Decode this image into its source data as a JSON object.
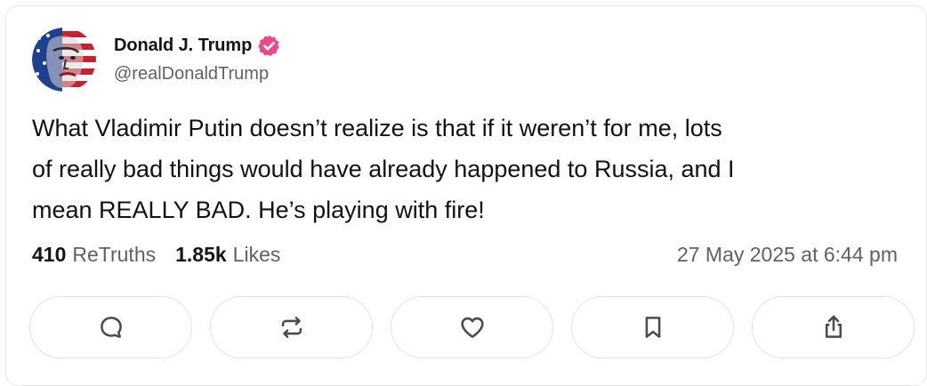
{
  "author": {
    "name": "Donald J. Trump",
    "handle": "@realDonaldTrump",
    "verified_color": "#ea4c89",
    "avatar_icon": "flag-portrait-avatar"
  },
  "post": {
    "text": "What Vladimir Putin doesn’t realize is that if it weren’t for me, lots\nof really bad things would have already happened to Russia, and I\nmean REALLY BAD. He’s playing with fire!"
  },
  "stats": {
    "retruths_count": "410",
    "retruths_label": "ReTruths",
    "likes_count": "1.85k",
    "likes_label": "Likes"
  },
  "timestamp": "27 May 2025 at 6:44 pm",
  "actions": [
    {
      "icon": "reply-icon"
    },
    {
      "icon": "retruth-icon"
    },
    {
      "icon": "like-heart-icon"
    },
    {
      "icon": "bookmark-icon"
    },
    {
      "icon": "share-icon"
    }
  ],
  "colors": {
    "text_primary": "#14141a",
    "text_secondary": "#5f5f6b",
    "border": "#e3e3e8",
    "icon": "#4a4a55"
  }
}
